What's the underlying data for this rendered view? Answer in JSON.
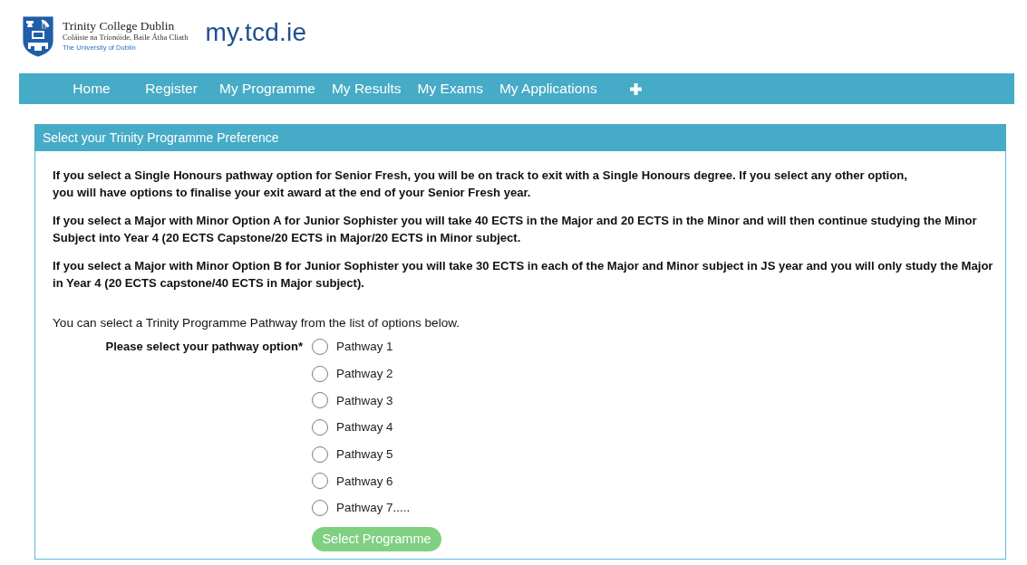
{
  "header": {
    "logo": {
      "name": "Trinity College Dublin",
      "irish_name": "Coláiste na Tríonóide, Baile Átha Cliath",
      "tagline": "The University of Dublin"
    },
    "site_title": "my.tcd.ie"
  },
  "nav": {
    "items": [
      {
        "label": "Home"
      },
      {
        "label": "Register"
      },
      {
        "label": "My Programme"
      },
      {
        "label": "My Results"
      },
      {
        "label": "My Exams"
      },
      {
        "label": "My Applications"
      }
    ]
  },
  "panel": {
    "title": "Select your Trinity Programme Preference",
    "notes": [
      "If you select a Single Honours pathway option for Senior Fresh, you will be on track to exit with a Single Honours degree. If you select any other option,\nyou will have options to finalise your exit award at the end of your Senior Fresh year.",
      "If you select a Major with Minor Option A for Junior Sophister you will take 40 ECTS in the Major and 20 ECTS in the Minor and will then continue studying the Minor Subject into Year 4 (20 ECTS Capstone/20 ECTS in Major/20 ECTS in Minor subject.",
      "If you select a Major with Minor Option B for Junior Sophister you will take 30 ECTS in each of the Major and Minor subject in JS year and you will only study the Major in Year 4 (20 ECTS capstone/40 ECTS in Major subject)."
    ],
    "intro": "You can select a Trinity Programme Pathway from the list of options below.",
    "pathway": {
      "label": "Please select your pathway option*",
      "options": [
        {
          "label": "Pathway 1",
          "selected": false
        },
        {
          "label": "Pathway 2",
          "selected": false
        },
        {
          "label": "Pathway 3",
          "selected": false
        },
        {
          "label": "Pathway 4",
          "selected": false
        },
        {
          "label": "Pathway 5",
          "selected": false
        },
        {
          "label": "Pathway 6",
          "selected": false
        },
        {
          "label": "Pathway 7.....",
          "selected": false
        }
      ]
    },
    "submit": {
      "label": "Select Programme",
      "disabled": true
    }
  }
}
